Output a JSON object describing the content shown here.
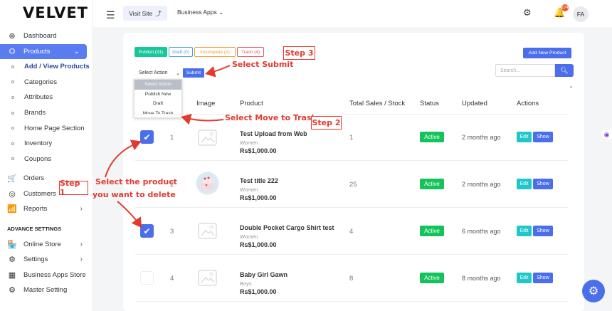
{
  "brand": {
    "logo": "VELVET"
  },
  "sidebar": {
    "items": [
      {
        "label": "Dashboard",
        "icon": "dashboard-icon",
        "glyph": "⊛"
      },
      {
        "label": "Products",
        "icon": "products-icon",
        "glyph": "⛭"
      }
    ],
    "sub_items": [
      "Add / View Products",
      "Categories",
      "Attributes",
      "Brands",
      "Home Page Section",
      "Inventory",
      "Coupons"
    ],
    "bottom_items": [
      {
        "label": "Orders",
        "glyph": "🛒"
      },
      {
        "label": "Customers",
        "glyph": "◎"
      },
      {
        "label": "Reports",
        "glyph": "📶"
      }
    ],
    "section_title": "ADVANCE SETTINGS",
    "adv_items": [
      {
        "label": "Online Store",
        "glyph": "🏪"
      },
      {
        "label": "Settings",
        "glyph": "⚙"
      },
      {
        "label": "Business Apps Store",
        "glyph": "▦"
      },
      {
        "label": "Master Setting",
        "glyph": "⚙"
      }
    ]
  },
  "topbar": {
    "visit_site": "Visit Site",
    "business_apps": "Business Apps",
    "notif_count": "174",
    "avatar": "FA"
  },
  "filters": {
    "publish": "Publish (31)",
    "draft": "Draft (0)",
    "incomplete": "Incomplete (2)",
    "trash": "Trash (4)"
  },
  "add_new_label": "Add New Product",
  "bulk": {
    "select_label": "Select Action",
    "submit_label": "Submit",
    "options": [
      "Select Action",
      "Publish Now",
      "Draft",
      "Move To Trash"
    ]
  },
  "search": {
    "placeholder": "Search..."
  },
  "table": {
    "headers": [
      "Image",
      "Product",
      "Total Sales / Stock",
      "Status",
      "Updated",
      "Actions"
    ],
    "rows": [
      {
        "idx": "1",
        "name": "Test Upload from Web",
        "cat": "Women",
        "price": "Rs$1,000.00",
        "stock": "1",
        "status": "Active",
        "updated": "2 months ago",
        "checked": true
      },
      {
        "idx": "2",
        "name": "Test title 222",
        "cat": "Women",
        "price": "Rs$1,000.00",
        "stock": "25",
        "status": "Active",
        "updated": "2 months ago",
        "checked": false
      },
      {
        "idx": "3",
        "name": "Double Pocket Cargo Shirt test",
        "cat": "Women",
        "price": "Rs$1,000.00",
        "stock": "4",
        "status": "Active",
        "updated": "6 months ago",
        "checked": true
      },
      {
        "idx": "4",
        "name": "Baby Girl Gawn",
        "cat": "Boys",
        "price": "Rs$1,000.00",
        "stock": "8",
        "status": "Active",
        "updated": "8 months ago",
        "checked": false
      }
    ],
    "edit_label": "Edit",
    "show_label": "Show"
  },
  "annotations": {
    "step1": "Step 1",
    "step2": "Step 2",
    "step3": "Step 3",
    "select_product_1": "Select the product",
    "select_product_2": "you want to delete",
    "move_to_trash": "Select Move to Trash",
    "select_submit": "Select Submit"
  },
  "colors": {
    "accent": "#4b6fea",
    "active": "#14c45a",
    "annotation": "#e23a2e",
    "publish": "#16c79a",
    "draft": "#4b9fe8",
    "incomplete": "#f0a030",
    "trash": "#e85a5a"
  }
}
